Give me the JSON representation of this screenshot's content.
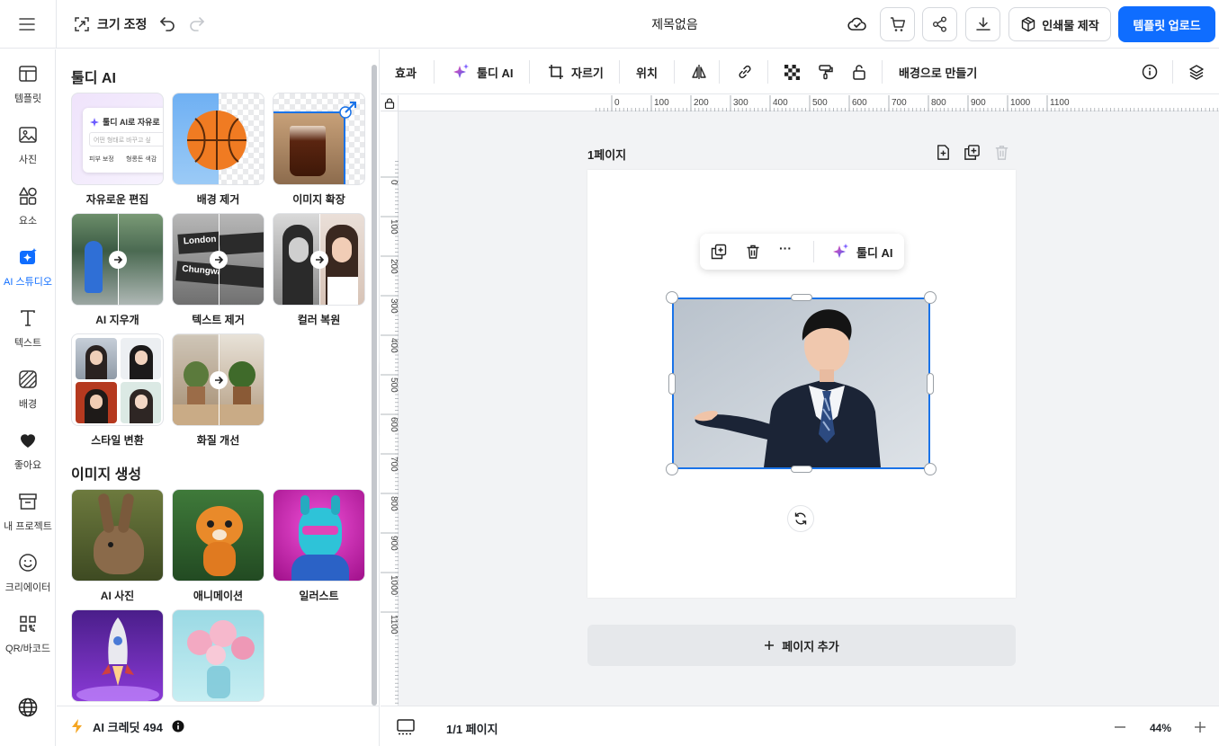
{
  "header": {
    "resize_label": "크기 조정",
    "doc_title": "제목없음",
    "print_label": "인쇄물 제작",
    "upload_label": "템플릿 업로드",
    "accent": "#0f6dff"
  },
  "rail": {
    "items": [
      {
        "label": "템플릿",
        "icon": "template-icon"
      },
      {
        "label": "사진",
        "icon": "photo-icon"
      },
      {
        "label": "요소",
        "icon": "shapes-icon"
      },
      {
        "label": "AI 스튜디오",
        "icon": "ai-sparkle-icon"
      },
      {
        "label": "텍스트",
        "icon": "text-icon"
      },
      {
        "label": "배경",
        "icon": "background-icon"
      },
      {
        "label": "좋아요",
        "icon": "heart-icon"
      },
      {
        "label": "내 프로젝트",
        "icon": "archive-icon"
      },
      {
        "label": "크리에이터",
        "icon": "smile-icon"
      },
      {
        "label": "QR/바코드",
        "icon": "qr-icon"
      }
    ]
  },
  "panel": {
    "ai_title": "툴디 AI",
    "ai_tools": [
      {
        "label": "자유로운 편집"
      },
      {
        "label": "배경 제거"
      },
      {
        "label": "이미지 확장"
      },
      {
        "label": "AI 지우개"
      },
      {
        "label": "텍스트 제거"
      },
      {
        "label": "컬러 복원"
      },
      {
        "label": "스타일 변환"
      },
      {
        "label": "화질 개선"
      }
    ],
    "free_edit_preview": {
      "title": "툴디 AI로 자유로",
      "placeholder": "어떤 형태로 바꾸고 싶",
      "chip1": "피부 보정",
      "chip2": "형롱돈 색감"
    },
    "text_remove_preview": {
      "sign1": "London",
      "sign2": "Chungwa"
    },
    "gen_title": "이미지 생성",
    "gen_items": [
      {
        "label": "AI 사진"
      },
      {
        "label": "애니메이션"
      },
      {
        "label": "일러스트"
      },
      {
        "label": ""
      },
      {
        "label": ""
      }
    ],
    "credits": "AI 크레딧 494"
  },
  "toolbar": {
    "effect": "효과",
    "ai": "툴디 AI",
    "crop": "자르기",
    "position": "위치",
    "make_bg": "배경으로 만들기"
  },
  "canvas": {
    "page_label": "1페이지",
    "ctx_ai": "툴디 AI",
    "ctx_more": "···",
    "add_page": "페이지 추가",
    "ruler_top": [
      "0",
      "100",
      "200",
      "300",
      "400",
      "500",
      "600",
      "700",
      "800",
      "900",
      "1000",
      "1100"
    ],
    "ruler_left": [
      "0",
      "100",
      "200",
      "300",
      "400",
      "500",
      "600",
      "700",
      "800",
      "900",
      "1000",
      "1100"
    ]
  },
  "bottom": {
    "pages": "1/1 페이지",
    "zoom": "44%"
  }
}
